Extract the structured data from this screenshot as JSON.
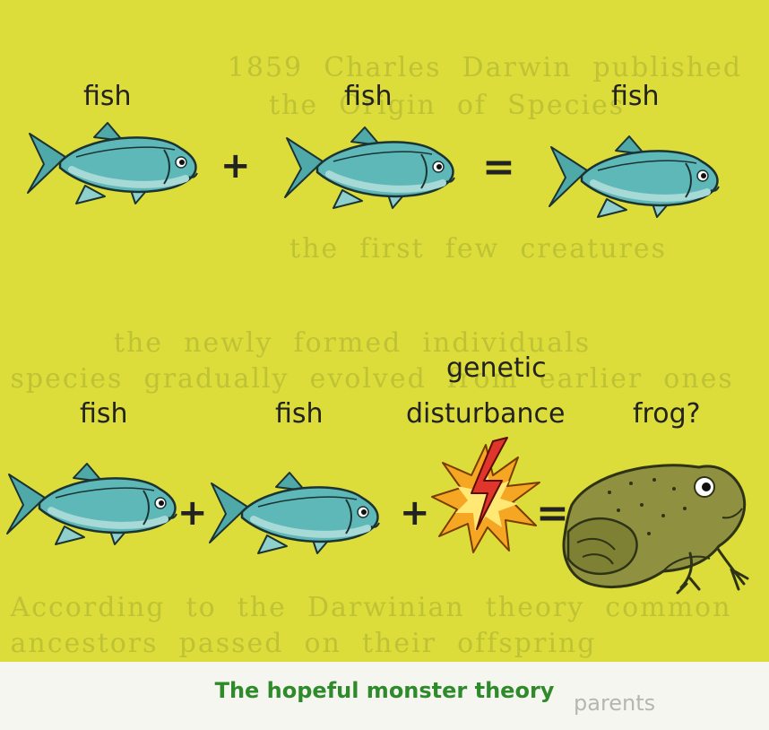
{
  "row1": {
    "label_1": "fish",
    "label_2": "fish",
    "label_3": "fish",
    "plus": "+",
    "equals": "="
  },
  "row2": {
    "label_1": "fish",
    "label_2": "fish",
    "label_3a": "genetic",
    "label_3b": "disturbance",
    "label_4": "frog?",
    "plus": "+",
    "equals": "="
  },
  "caption": "The hopeful monster theory",
  "colors": {
    "background": "#dcdc3a",
    "fish_body": "#5fb8b8",
    "fish_belly": "#a7d9d6",
    "frog_body": "#8f9140",
    "burst": "#f5a623",
    "bolt": "#e0352b",
    "caption": "#2e8a2a"
  }
}
